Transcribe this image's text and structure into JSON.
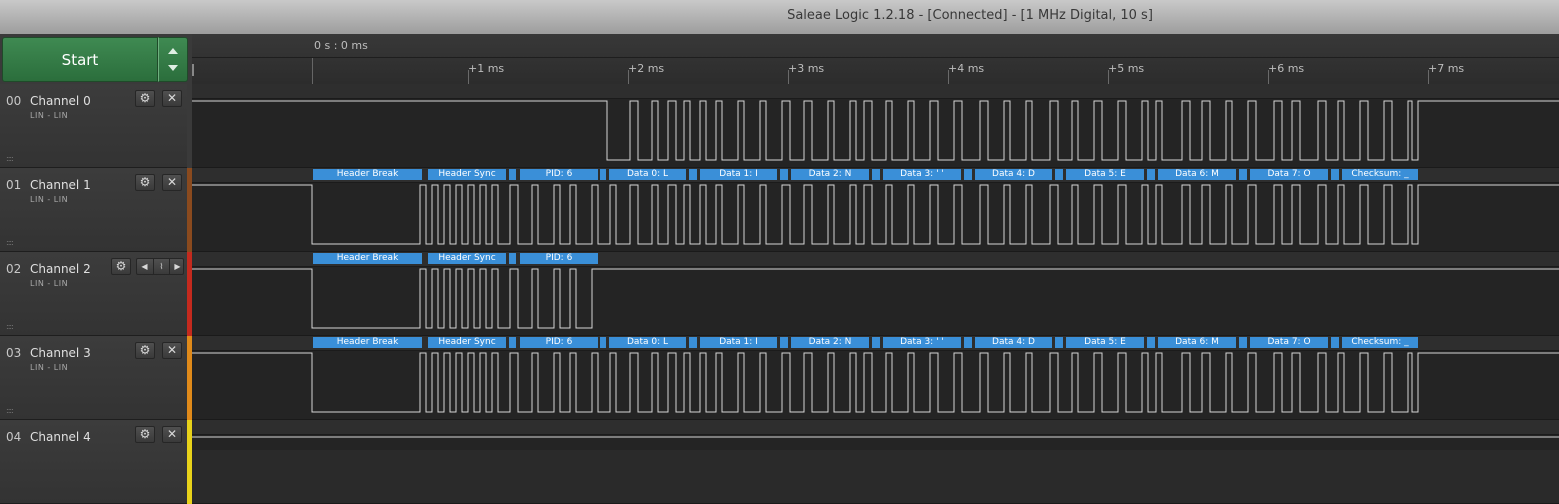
{
  "window": {
    "title": "Saleae Logic 1.2.18 - [Connected] - [1 MHz Digital, 10 s]"
  },
  "toolbar": {
    "start_label": "Start"
  },
  "ruler": {
    "origin_label": "0 s : 0 ms",
    "ticks": [
      "+1 ms",
      "+2 ms",
      "+3 ms",
      "+4 ms",
      "+5 ms",
      "+6 ms",
      "+7 ms"
    ]
  },
  "channels": [
    {
      "number": "00",
      "name": "Channel 0",
      "analyzer": "LIN - LIN",
      "color": "#3a3a3a",
      "trigger": false
    },
    {
      "number": "01",
      "name": "Channel 1",
      "analyzer": "LIN - LIN",
      "color": "#8a4a1e",
      "trigger": false
    },
    {
      "number": "02",
      "name": "Channel 2",
      "analyzer": "LIN - LIN",
      "color": "#c42a1e",
      "trigger": true
    },
    {
      "number": "03",
      "name": "Channel 3",
      "analyzer": "LIN - LIN",
      "color": "#e08a1a",
      "trigger": false
    },
    {
      "number": "04",
      "name": "Channel 4",
      "analyzer": "",
      "color": "#e8d21a",
      "trigger": false
    }
  ],
  "icons": {
    "gear": "gear-icon",
    "close": "close-icon",
    "trigger_left": "arrow-left-icon",
    "trigger_edge": "falling-edge-icon",
    "trigger_right": "arrow-right-icon"
  },
  "annotations": {
    "full_frame": [
      "Header Break",
      "Header Sync",
      "PID: 6",
      "Data 0: L",
      "Data 1: I",
      "Data 2: N",
      "Data 3: ' '",
      "Data 4: D",
      "Data 5: E",
      "Data 6: M",
      "Data 7: O",
      "Checksum: _"
    ],
    "header_only": [
      "Header Break",
      "Header Sync",
      "PID: 6"
    ]
  },
  "colors": {
    "annotation": "#3a8fd8",
    "trace": "#d6d6d6",
    "start_button": "#2f7a44"
  }
}
